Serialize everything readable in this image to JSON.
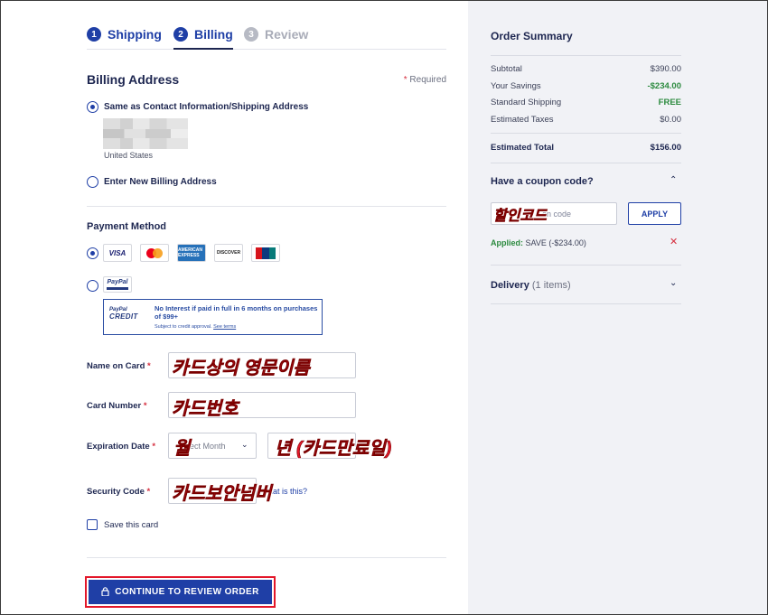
{
  "steps": [
    {
      "num": "1",
      "label": "Shipping"
    },
    {
      "num": "2",
      "label": "Billing"
    },
    {
      "num": "3",
      "label": "Review"
    }
  ],
  "billing": {
    "title": "Billing Address",
    "required_mark": "*",
    "required_label": " Required",
    "same_as_label": "Same as Contact Information/Shipping Address",
    "country": "United States",
    "new_address_label": "Enter New Billing Address"
  },
  "payment": {
    "title": "Payment Method",
    "cards": {
      "visa": "VISA",
      "amex": "AMERICAN EXPRESS",
      "discover": "DISCOVER"
    },
    "paypal_badge": "PayPal",
    "credit": {
      "logo_top": "PayPal",
      "logo_bottom": "CREDIT",
      "text": "No Interest if paid in full in 6 months on purchases of $99+",
      "sub": "Subject to credit approval.",
      "see_terms": "See terms"
    }
  },
  "fields": {
    "name_label": "Name on Card",
    "card_label": "Card Number",
    "exp_label": "Expiration Date",
    "sec_label": "Security Code",
    "star": "*",
    "month_placeholder": "ect Month",
    "what_is_this": "hat is this?",
    "save_card_label": "Save this card"
  },
  "annotations": {
    "name": "카드상의 영문이름",
    "card": "카드번호",
    "month": "월",
    "year": "년 (카드만료일)",
    "security": "카드보안넘버",
    "coupon": "할인코드"
  },
  "cta": {
    "label": "CONTINUE TO REVIEW ORDER"
  },
  "summary": {
    "title": "Order Summary",
    "rows": [
      {
        "label": "Subtotal",
        "value": "$390.00"
      },
      {
        "label": "Your Savings",
        "value": "-$234.00"
      },
      {
        "label": "Standard Shipping",
        "value": "FREE"
      },
      {
        "label": "Estimated Taxes",
        "value": "$0.00"
      }
    ],
    "total": {
      "label": "Estimated Total",
      "value": "$156.00"
    },
    "coupon_title": "Have a coupon code?",
    "coupon_placeholder": "on code",
    "apply_label": "APPLY",
    "applied_label": "Applied:",
    "applied_value": " SAVE (-$234.00)",
    "remove_icon": "✕",
    "delivery_label": "Delivery",
    "delivery_count": " (1 items)"
  },
  "colors": {
    "accent": "#1f3fa6",
    "navy": "#1d2650",
    "green": "#2b8a3e",
    "red": "#e3172a",
    "panel": "#f1f2f6"
  }
}
